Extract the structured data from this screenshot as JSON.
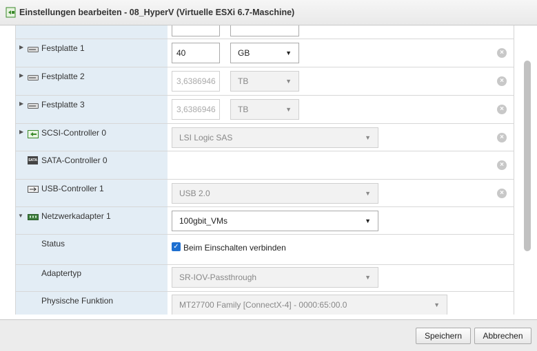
{
  "window": {
    "title": "Einstellungen bearbeiten - 08_HyperV (Virtuelle ESXi 6.7-Maschine)"
  },
  "rows": {
    "disk1": {
      "label": "Festplatte 1",
      "size_value": "40",
      "unit": "GB",
      "remove_icon": "close-circle-icon"
    },
    "disk2": {
      "label": "Festplatte 2",
      "size_value": "3,6386946",
      "unit": "TB",
      "remove_icon": "close-circle-icon"
    },
    "disk3": {
      "label": "Festplatte 3",
      "size_value": "3,6386946",
      "unit": "TB",
      "remove_icon": "close-circle-icon"
    },
    "scsi": {
      "label": "SCSI-Controller 0",
      "value": "LSI Logic SAS"
    },
    "sata": {
      "label": "SATA-Controller 0",
      "icon_text": "SATA"
    },
    "usb": {
      "label": "USB-Controller 1",
      "value": "USB 2.0"
    },
    "net": {
      "label": "Netzwerkadapter 1",
      "value": "100gbit_VMs",
      "status_label": "Status",
      "status_checkbox": {
        "checked": true,
        "label": "Beim Einschalten verbinden"
      },
      "adaptertyp_label": "Adaptertyp",
      "adaptertyp_value": "SR-IOV-Passthrough",
      "physfunc_label": "Physische Funktion",
      "physfunc_value": "MT27700 Family [ConnectX-4] - 0000:65:00.0"
    }
  },
  "footer": {
    "save_label": "Speichern",
    "cancel_label": "Abbrechen"
  },
  "icons": {
    "title": "vm-settings-icon",
    "disk": "hard-disk-icon",
    "scsi": "scsi-controller-icon",
    "usb": "usb-icon",
    "network": "network-adapter-icon",
    "expand": "triangle-right-icon",
    "collapse": "triangle-down-icon",
    "remove": "close-circle-icon"
  },
  "colors": {
    "label_bg": "#e3edf5",
    "checkbox": "#1e6fd0"
  }
}
